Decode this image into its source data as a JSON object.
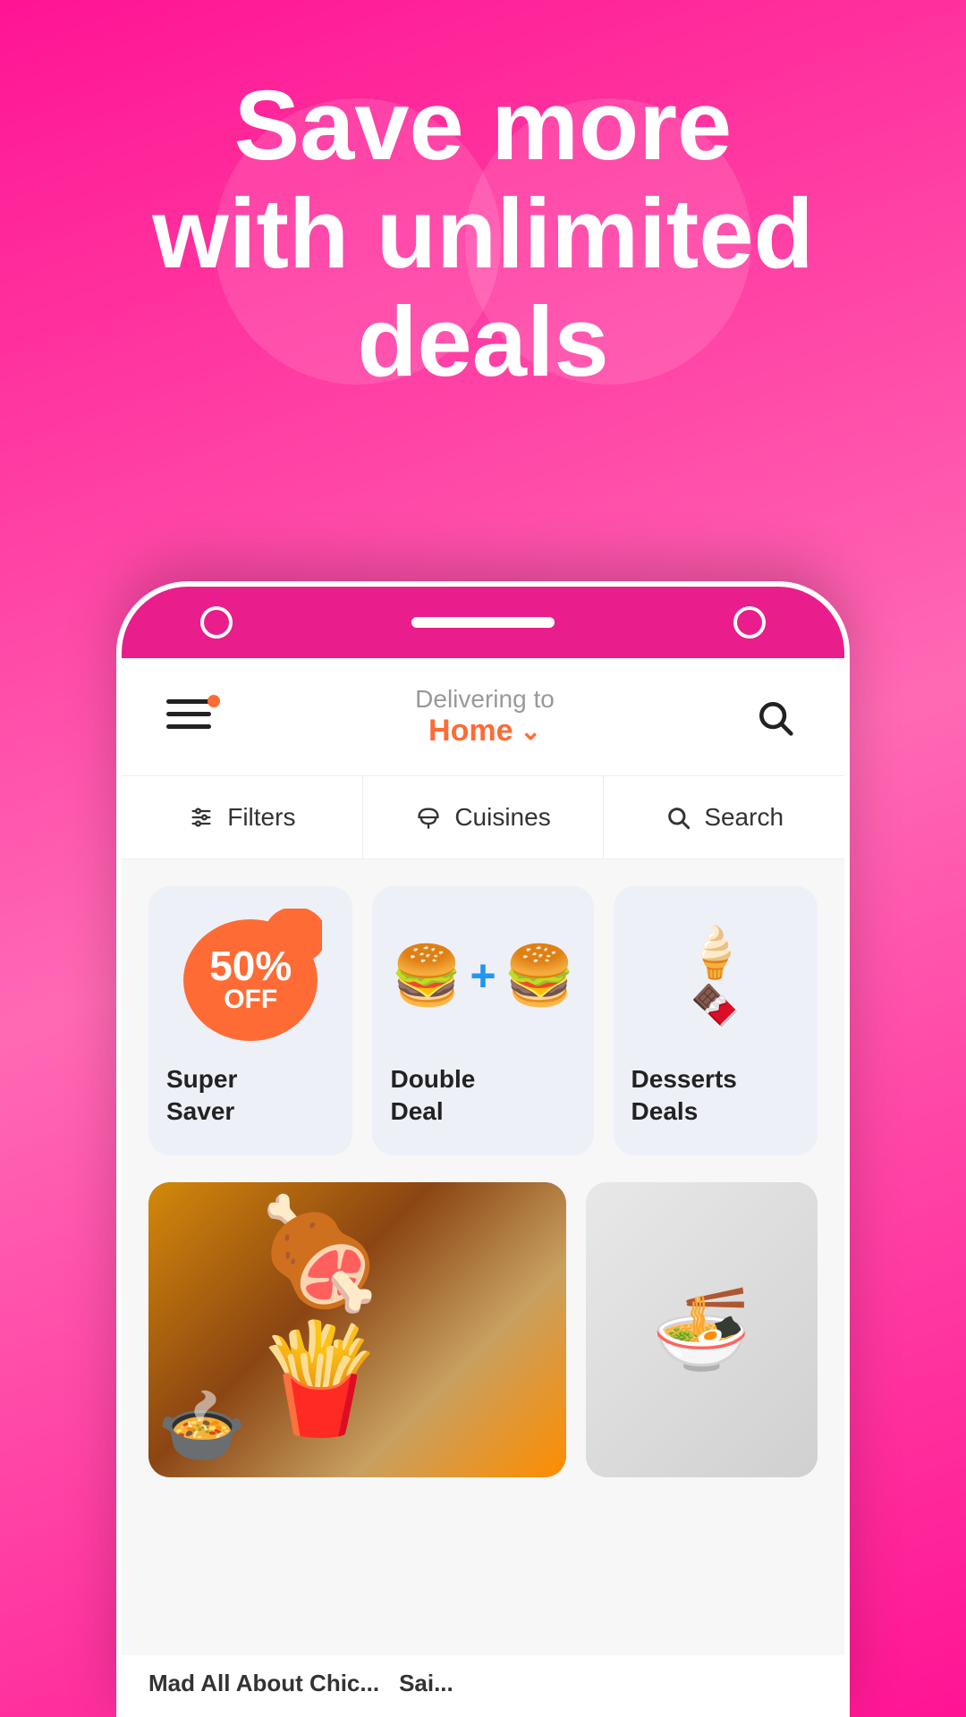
{
  "hero": {
    "title_line1": "Save more",
    "title_line2": "with unlimited",
    "title_line3": "deals"
  },
  "app": {
    "header": {
      "delivering_label": "Delivering to",
      "location": "Home",
      "location_icon": "chevron-down"
    },
    "filter_bar": {
      "filters_label": "Filters",
      "cuisines_label": "Cuisines",
      "search_label": "Search"
    },
    "deal_cards": [
      {
        "id": "super-saver",
        "badge_percent": "50%",
        "badge_text": "OFF",
        "title": "Super\nSaver"
      },
      {
        "id": "double-deal",
        "title": "Double\nDeal"
      },
      {
        "id": "desserts-deals",
        "title": "Desserts\nDeals"
      }
    ],
    "restaurant_labels": [
      "Mad All About Chic...",
      "Sai..."
    ]
  },
  "colors": {
    "brand_pink": "#ff1493",
    "brand_orange": "#ff6b35",
    "card_bg": "#eef0f8",
    "text_dark": "#222222",
    "text_gray": "#999999",
    "text_white": "#ffffff"
  }
}
